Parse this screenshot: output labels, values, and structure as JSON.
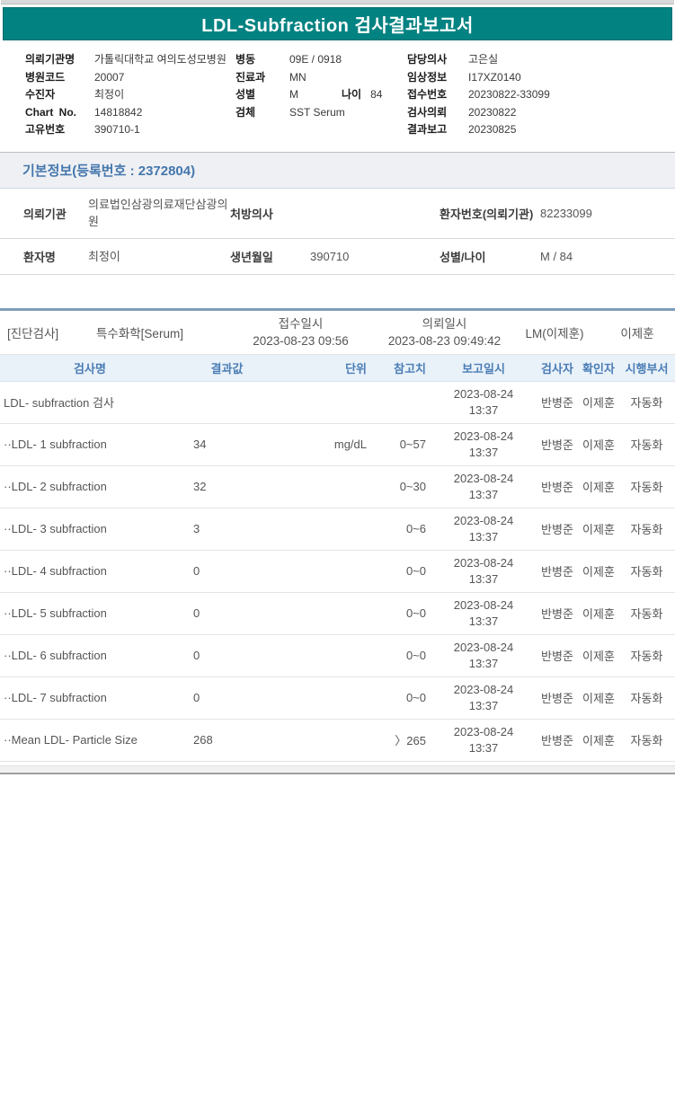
{
  "report": {
    "title": "LDL-Subfraction 검사결과보고서"
  },
  "colors": {
    "title_bar": "#038282",
    "section_border": "#7d9cb8",
    "header_blue": "#4a7db5",
    "basic_band_bg": "#eef0f4"
  },
  "header_info": {
    "rows": [
      {
        "l1": "의뢰기관명",
        "v1": "가톨릭대학교 여의도성모병원",
        "l2": "병동",
        "v2": "09E / 0918",
        "l2b": "",
        "v2b": "",
        "l3": "담당의사",
        "v3": "고은실"
      },
      {
        "l1": "병원코드",
        "v1": "20007",
        "l2": "진료과",
        "v2": "MN",
        "l2b": "",
        "v2b": "",
        "l3": "임상정보",
        "v3": "I17XZ0140"
      },
      {
        "l1": "수진자",
        "v1": "최정이",
        "l2": "성별",
        "v2": "M",
        "l2b": "나이",
        "v2b": "84",
        "l3": "접수번호",
        "v3": "20230822-33099"
      },
      {
        "l1": "Chart No.",
        "v1": "14818842",
        "l2": "검체",
        "v2": "SST Serum",
        "l2b": "",
        "v2b": "",
        "l3": "검사의뢰",
        "v3": "20230822"
      },
      {
        "l1": "고유번호",
        "v1": "390710-1",
        "l2": "",
        "v2": "",
        "l2b": "",
        "v2b": "",
        "l3": "결과보고",
        "v3": "20230825"
      }
    ]
  },
  "basic_info": {
    "title": "기본정보(등록번호 : 2372804)"
  },
  "patient": {
    "rows": [
      {
        "l1": "의뢰기관",
        "v1": "의료법인삼광의료재단삼광의원",
        "l2": "처방의사",
        "v2": "",
        "l3": "환자번호(의뢰기관)",
        "v3": "82233099"
      },
      {
        "l1": "환자명",
        "v1": "최정이",
        "l2": "생년월일",
        "v2": "390710",
        "l3": "성별/나이",
        "v3": "M / 84"
      }
    ]
  },
  "section": {
    "category": "[진단검사]",
    "test_group": "특수화학[Serum]",
    "receipt_label": "접수일시",
    "receipt_time": "2023-08-23 09:56",
    "request_label": "의뢰일시",
    "request_time": "2023-08-23 09:49:42",
    "lm": "LM(이제훈)",
    "doctor": "이제훈"
  },
  "results": {
    "headers": [
      "검사명",
      "결과값",
      "단위",
      "참고치",
      "보고일시",
      "검사자",
      "확인자",
      "시행부서"
    ],
    "rows": [
      {
        "name": "LDL- subfraction 검사",
        "value": "",
        "unit": "",
        "ref": "",
        "date": "2023-08-24",
        "time": "13:37",
        "tester": "반병준",
        "confirmer": "이제훈",
        "dept": "자동화"
      },
      {
        "name": "··LDL- 1 subfraction",
        "value": "34",
        "unit": "mg/dL",
        "ref": "0~57",
        "date": "2023-08-24",
        "time": "13:37",
        "tester": "반병준",
        "confirmer": "이제훈",
        "dept": "자동화"
      },
      {
        "name": "··LDL- 2 subfraction",
        "value": "32",
        "unit": "",
        "ref": "0~30",
        "date": "2023-08-24",
        "time": "13:37",
        "tester": "반병준",
        "confirmer": "이제훈",
        "dept": "자동화"
      },
      {
        "name": "··LDL- 3 subfraction",
        "value": "3",
        "unit": "",
        "ref": "0~6",
        "date": "2023-08-24",
        "time": "13:37",
        "tester": "반병준",
        "confirmer": "이제훈",
        "dept": "자동화"
      },
      {
        "name": "··LDL- 4 subfraction",
        "value": "0",
        "unit": "",
        "ref": "0~0",
        "date": "2023-08-24",
        "time": "13:37",
        "tester": "반병준",
        "confirmer": "이제훈",
        "dept": "자동화"
      },
      {
        "name": "··LDL- 5 subfraction",
        "value": "0",
        "unit": "",
        "ref": "0~0",
        "date": "2023-08-24",
        "time": "13:37",
        "tester": "반병준",
        "confirmer": "이제훈",
        "dept": "자동화"
      },
      {
        "name": "··LDL- 6 subfraction",
        "value": "0",
        "unit": "",
        "ref": "0~0",
        "date": "2023-08-24",
        "time": "13:37",
        "tester": "반병준",
        "confirmer": "이제훈",
        "dept": "자동화"
      },
      {
        "name": "··LDL- 7 subfraction",
        "value": "0",
        "unit": "",
        "ref": "0~0",
        "date": "2023-08-24",
        "time": "13:37",
        "tester": "반병준",
        "confirmer": "이제훈",
        "dept": "자동화"
      },
      {
        "name": "··Mean LDL- Particle Size",
        "value": "268",
        "unit": "",
        "ref": "〉265",
        "date": "2023-08-24",
        "time": "13:37",
        "tester": "반병준",
        "confirmer": "이제훈",
        "dept": "자동화"
      }
    ]
  }
}
